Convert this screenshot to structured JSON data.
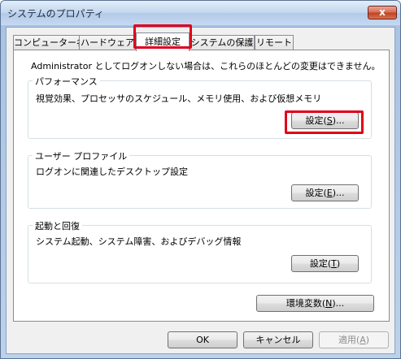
{
  "window": {
    "title": "システムのプロパティ",
    "close_label": "x"
  },
  "tabs": [
    {
      "label": "コンピューター名"
    },
    {
      "label": "ハードウェア"
    },
    {
      "label": "詳細設定"
    },
    {
      "label": "システムの保護"
    },
    {
      "label": "リモート"
    }
  ],
  "active_tab": "詳細設定",
  "admin_note": "Administrator としてログオンしない場合は、これらのほとんどの変更はできません。",
  "performance": {
    "title": "パフォーマンス",
    "description": "視覚効果、プロセッサのスケジュール、メモリ使用、および仮想メモリ",
    "button_pre": "設定(",
    "button_key": "S",
    "button_post": ")..."
  },
  "user_profile": {
    "title": "ユーザー プロファイル",
    "description": "ログオンに関連したデスクトップ設定",
    "button_pre": "設定(",
    "button_key": "E",
    "button_post": ")..."
  },
  "startup": {
    "title": "起動と回復",
    "description": "システム起動、システム障害、およびデバッグ情報",
    "button_pre": "設定(",
    "button_key": "T",
    "button_post": ")"
  },
  "env_button": {
    "pre": "環境変数(",
    "key": "N",
    "post": ")..."
  },
  "footer": {
    "ok": "OK",
    "cancel": "キャンセル",
    "apply_pre": "適用(",
    "apply_key": "A",
    "apply_post": ")"
  },
  "highlight_color": "#e0001b"
}
